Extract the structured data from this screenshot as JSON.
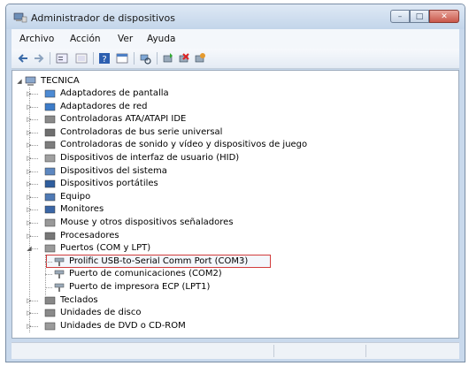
{
  "window": {
    "title": "Administrador de dispositivos",
    "controls": [
      "minimize",
      "maximize",
      "close"
    ]
  },
  "menu": [
    "Archivo",
    "Acción",
    "Ver",
    "Ayuda"
  ],
  "toolbar_icons": [
    "back-icon",
    "forward-icon",
    "properties-icon",
    "show-hidden-icon",
    "help-icon",
    "view-icon",
    "scan-hardware-icon",
    "update-driver-icon",
    "disable-device-icon",
    "uninstall-icon"
  ],
  "tree": {
    "root": "TECNICA",
    "categories": [
      {
        "label": "Adaptadores de pantalla",
        "icon": "display-adapter-icon",
        "expanded": false
      },
      {
        "label": "Adaptadores de red",
        "icon": "network-adapter-icon",
        "expanded": false
      },
      {
        "label": "Controladoras ATA/ATAPI IDE",
        "icon": "ide-controller-icon",
        "expanded": false
      },
      {
        "label": "Controladoras de bus serie universal",
        "icon": "usb-icon",
        "expanded": false
      },
      {
        "label": "Controladoras de sonido y vídeo y dispositivos de juego",
        "icon": "sound-icon",
        "expanded": false
      },
      {
        "label": "Dispositivos de interfaz de usuario (HID)",
        "icon": "hid-icon",
        "expanded": false
      },
      {
        "label": "Dispositivos del sistema",
        "icon": "system-device-icon",
        "expanded": false
      },
      {
        "label": "Dispositivos portátiles",
        "icon": "portable-device-icon",
        "expanded": false
      },
      {
        "label": "Equipo",
        "icon": "computer-icon",
        "expanded": false
      },
      {
        "label": "Monitores",
        "icon": "monitor-icon",
        "expanded": false
      },
      {
        "label": "Mouse y otros dispositivos señaladores",
        "icon": "mouse-icon",
        "expanded": false
      },
      {
        "label": "Procesadores",
        "icon": "processor-icon",
        "expanded": false
      },
      {
        "label": "Puertos (COM y LPT)",
        "icon": "port-icon",
        "expanded": true,
        "children": [
          {
            "label": "Prolific USB-to-Serial Comm Port (COM3)",
            "highlighted": true
          },
          {
            "label": "Puerto de comunicaciones (COM2)",
            "highlighted": false
          },
          {
            "label": "Puerto de impresora ECP (LPT1)",
            "highlighted": false
          }
        ]
      },
      {
        "label": "Teclados",
        "icon": "keyboard-icon",
        "expanded": false
      },
      {
        "label": "Unidades de disco",
        "icon": "disk-drive-icon",
        "expanded": false
      },
      {
        "label": "Unidades de DVD o CD-ROM",
        "icon": "dvd-drive-icon",
        "expanded": false
      }
    ]
  },
  "colors": {
    "highlight_border": "#d23c3c",
    "window_frame": "#c9d9ec"
  }
}
